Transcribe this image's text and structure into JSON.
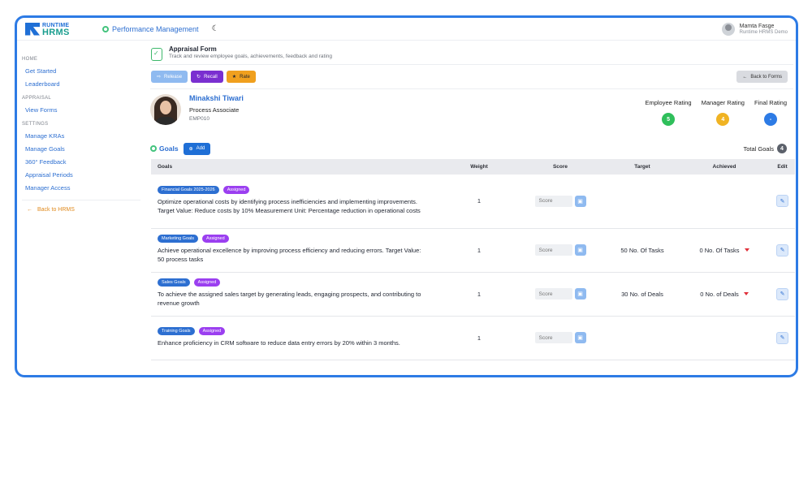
{
  "header": {
    "logo_top": "RUNTIME",
    "logo_bottom": "HRMS",
    "app_title": "Performance Management",
    "moon_glyph": "☾",
    "user_name": "Mamta Fasge",
    "user_org": "Runtime HRMS Demo"
  },
  "sidebar": {
    "sections": [
      {
        "title": "HOME",
        "items": [
          "Get Started",
          "Leaderboard"
        ]
      },
      {
        "title": "APPRAISAL",
        "items": [
          "View Forms"
        ]
      },
      {
        "title": "SETTINGS",
        "items": [
          "Manage KRAs",
          "Manage Goals",
          "360° Feedback",
          "Appraisal Periods",
          "Manager Access"
        ]
      }
    ],
    "back_label": "Back to HRMS"
  },
  "form": {
    "title": "Appraisal Form",
    "subtitle": "Track and review employee goals, achievements, feedback and rating"
  },
  "actions": {
    "release": "Release",
    "recall": "Recall",
    "rate": "Rate",
    "back_to_forms": "Back to Forms"
  },
  "employee": {
    "name": "Minakshi Tiwari",
    "role": "Process Associate",
    "id": "EMP010"
  },
  "ratings": [
    {
      "label": "Employee Rating",
      "value": "5",
      "color": "#2fbf5b"
    },
    {
      "label": "Manager Rating",
      "value": "4",
      "color": "#f0b323"
    },
    {
      "label": "Final Rating",
      "value": "-",
      "color": "#2d7be5"
    }
  ],
  "goals": {
    "title": "Goals",
    "add_label": "Add",
    "total_label": "Total Goals",
    "total_count": "4",
    "columns": [
      "Goals",
      "Weight",
      "Score",
      "Target",
      "Achieved",
      "Edit"
    ],
    "score_placeholder": "Score",
    "rows": [
      {
        "category": "Financial Goals 2025-2026",
        "status": "Assigned",
        "description": "Optimize operational costs by identifying process inefficiencies and implementing improvements. Target Value: Reduce costs by 10% Measurement Unit: Percentage reduction in operational costs",
        "weight": "1",
        "target": "",
        "achieved": ""
      },
      {
        "category": "Marketing Goals",
        "status": "Assigned",
        "description": "Achieve operational excellence by improving process efficiency and reducing errors. Target Value: 50 process tasks",
        "weight": "1",
        "target": "50 No. Of Tasks",
        "achieved": "0 No. Of Tasks"
      },
      {
        "category": "Sales Goals",
        "status": "Assigned",
        "description": "To achieve the assigned sales target by generating leads, engaging prospects, and contributing to revenue growth",
        "weight": "1",
        "target": "30 No. of Deals",
        "achieved": "0 No. of Deals"
      },
      {
        "category": "Training Goals",
        "status": "Assigned",
        "description": "Enhance proficiency in CRM software to reduce data entry errors by 20% within 3 months.",
        "weight": "1",
        "target": "",
        "achieved": ""
      }
    ]
  },
  "colors": {
    "accent": "#2d7be5",
    "recall": "#7a2fd0",
    "rate": "#f0a01e",
    "tag_category": "#2d6fd1",
    "tag_status": "#9b3ff0"
  }
}
